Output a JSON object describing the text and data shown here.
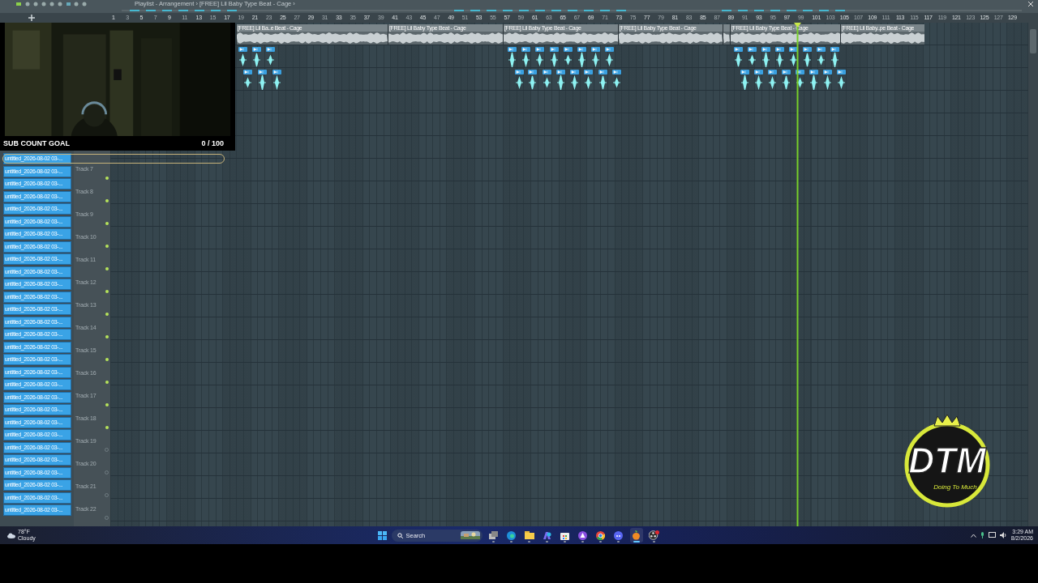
{
  "playlist": {
    "title": "Playlist - Arrangement › [FREE] Lil Baby Type Beat - Cage ›"
  },
  "ruler": [
    "1",
    "3",
    "5",
    "7",
    "9",
    "11",
    "13",
    "15",
    "17",
    "19",
    "21",
    "23",
    "25",
    "27",
    "29",
    "31",
    "33",
    "35",
    "37",
    "39",
    "41",
    "43",
    "45",
    "47",
    "49",
    "51",
    "53",
    "55",
    "57",
    "59",
    "61",
    "63",
    "65",
    "67",
    "69",
    "71",
    "73",
    "75",
    "77",
    "79",
    "81",
    "83",
    "85",
    "87",
    "89",
    "91",
    "93",
    "95",
    "97",
    "99",
    "101",
    "103",
    "105",
    "107",
    "109",
    "111",
    "113",
    "115",
    "117",
    "119",
    "121",
    "123",
    "125",
    "127",
    "129"
  ],
  "audio_clips": [
    {
      "kind": "labeled",
      "label": "[FREE] Lil Ba..e Beat - Cage"
    },
    {
      "kind": "labeled",
      "label": "[FREE] Lil Baby Type Beat - Cage"
    },
    {
      "kind": "labeled",
      "label": "[FREE] Lil Baby Type Beat - Cage"
    },
    {
      "kind": "labeled",
      "label": "[FREE] Lil Baby Type Beat - Cage"
    },
    {
      "kind": "marker"
    },
    {
      "kind": "labeled",
      "label": "[FREE] Lil Baby Type Beat - Cage"
    },
    {
      "kind": "labeled",
      "label": "[FREE] Lil Baby..pe Beat - Cage"
    }
  ],
  "picker": [
    {
      "label": "untitled_2026-08-02 03-..."
    },
    {
      "label": "untitled_2026-08-02 03-..."
    },
    {
      "label": "untitled_2026-08-02 03-..."
    },
    {
      "label": "untitled_2026-08-02 03-..."
    },
    {
      "label": "untitled_2026-08-02 03-..."
    },
    {
      "label": "untitled_2026-08-02 03-..."
    },
    {
      "label": "untitled_2026-08-02 03-..."
    },
    {
      "label": "untitled_2026-08-02 03-..."
    },
    {
      "label": "untitled_2026-08-02 03-..."
    },
    {
      "label": "untitled_2026-08-02 03-..."
    },
    {
      "label": "untitled_2026-08-02 03-..."
    },
    {
      "label": "untitled_2026-08-02 03-..."
    },
    {
      "label": "untitled_2026-08-02 03-..."
    },
    {
      "label": "untitled_2026-08-02 03-..."
    },
    {
      "label": "untitled_2026-08-02 03-..."
    },
    {
      "label": "untitled_2026-08-02 03-..."
    },
    {
      "label": "untitled_2026-08-02 03-..."
    },
    {
      "label": "untitled_2026-08-02 03-..."
    },
    {
      "label": "untitled_2026-08-02 03-..."
    },
    {
      "label": "untitled_2026-08-02 03-..."
    },
    {
      "label": "untitled_2026-08-02 03-..."
    },
    {
      "label": "untitled_2026-08-02 03-..."
    },
    {
      "label": "untitled_2026-08-02 03-..."
    },
    {
      "label": "untitled_2026-08-02 03-..."
    },
    {
      "label": "untitled_2026-08-02 03-..."
    },
    {
      "label": "untitled_2026-08-02 03-..."
    },
    {
      "label": "untitled_2026-08-02 03-..."
    },
    {
      "label": "untitled_2026-08-02 03-..."
    },
    {
      "label": "untitled_2026-08-02 03-..."
    }
  ],
  "tracks": [
    {
      "label": "Track 7",
      "enabled": true
    },
    {
      "label": "Track 8",
      "enabled": true
    },
    {
      "label": "Track 9",
      "enabled": true
    },
    {
      "label": "Track 10",
      "enabled": true
    },
    {
      "label": "Track 11",
      "enabled": true
    },
    {
      "label": "Track 12",
      "enabled": true
    },
    {
      "label": "Track 13",
      "enabled": true
    },
    {
      "label": "Track 14",
      "enabled": true
    },
    {
      "label": "Track 15",
      "enabled": true
    },
    {
      "label": "Track 16",
      "enabled": true
    },
    {
      "label": "Track 17",
      "enabled": true
    },
    {
      "label": "Track 18",
      "enabled": true
    },
    {
      "label": "Track 19",
      "enabled": false
    },
    {
      "label": "Track 20",
      "enabled": false
    },
    {
      "label": "Track 21",
      "enabled": false
    },
    {
      "label": "Track 22",
      "enabled": false
    }
  ],
  "webcam": {
    "kind": "picture",
    "goal_title": "SUB COUNT GOAL",
    "goal_count": "0 / 100",
    "level": 0
  },
  "logo": {
    "title": "DTM",
    "tagline": "Doing To Much"
  },
  "taskbar": {
    "weather_temp": "78°F",
    "weather_text": "Cloudy",
    "search": {
      "placeholder": "Search"
    },
    "apps": [
      {
        "kind": "taskview",
        "selected": false
      },
      {
        "kind": "edge",
        "selected": false
      },
      {
        "kind": "explorer",
        "selected": false
      },
      {
        "kind": "copilot",
        "selected": false
      },
      {
        "kind": "store",
        "selected": false
      },
      {
        "kind": "purple",
        "selected": false
      },
      {
        "kind": "chrome",
        "selected": false
      },
      {
        "kind": "discord",
        "selected": false
      },
      {
        "kind": "fl",
        "selected": true
      },
      {
        "kind": "obs",
        "selected": false
      }
    ],
    "time": "3:29 AM",
    "date": "8/2/2026"
  }
}
